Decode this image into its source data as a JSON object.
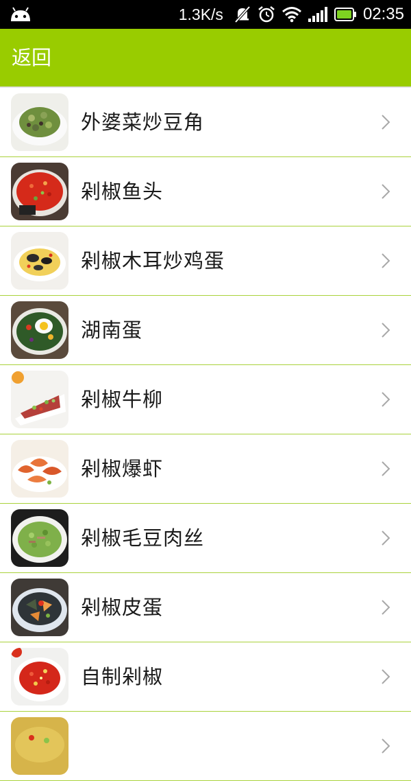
{
  "status_bar": {
    "net_speed": "1.3K/s",
    "time": "02:35",
    "icons": [
      "android-icon",
      "notifications-off-icon",
      "alarm-icon",
      "wifi-icon",
      "signal-icon",
      "battery-icon"
    ]
  },
  "header": {
    "back_label": "返回",
    "color": "#99cc00"
  },
  "recipes": [
    {
      "name": "外婆菜炒豆角",
      "image": "green-beans-dish"
    },
    {
      "name": "剁椒鱼头",
      "image": "chili-fish-head"
    },
    {
      "name": "剁椒木耳炒鸡蛋",
      "image": "woodear-egg-dish"
    },
    {
      "name": "湖南蛋",
      "image": "hunan-egg-dish"
    },
    {
      "name": "剁椒牛柳",
      "image": "beef-strips-dish"
    },
    {
      "name": "剁椒爆虾",
      "image": "shrimp-dish"
    },
    {
      "name": "剁椒毛豆肉丝",
      "image": "edamame-pork-dish"
    },
    {
      "name": "剁椒皮蛋",
      "image": "century-egg-dish"
    },
    {
      "name": "自制剁椒",
      "image": "chopped-chili-bowl"
    },
    {
      "name": "",
      "image": "partial-dish"
    }
  ]
}
